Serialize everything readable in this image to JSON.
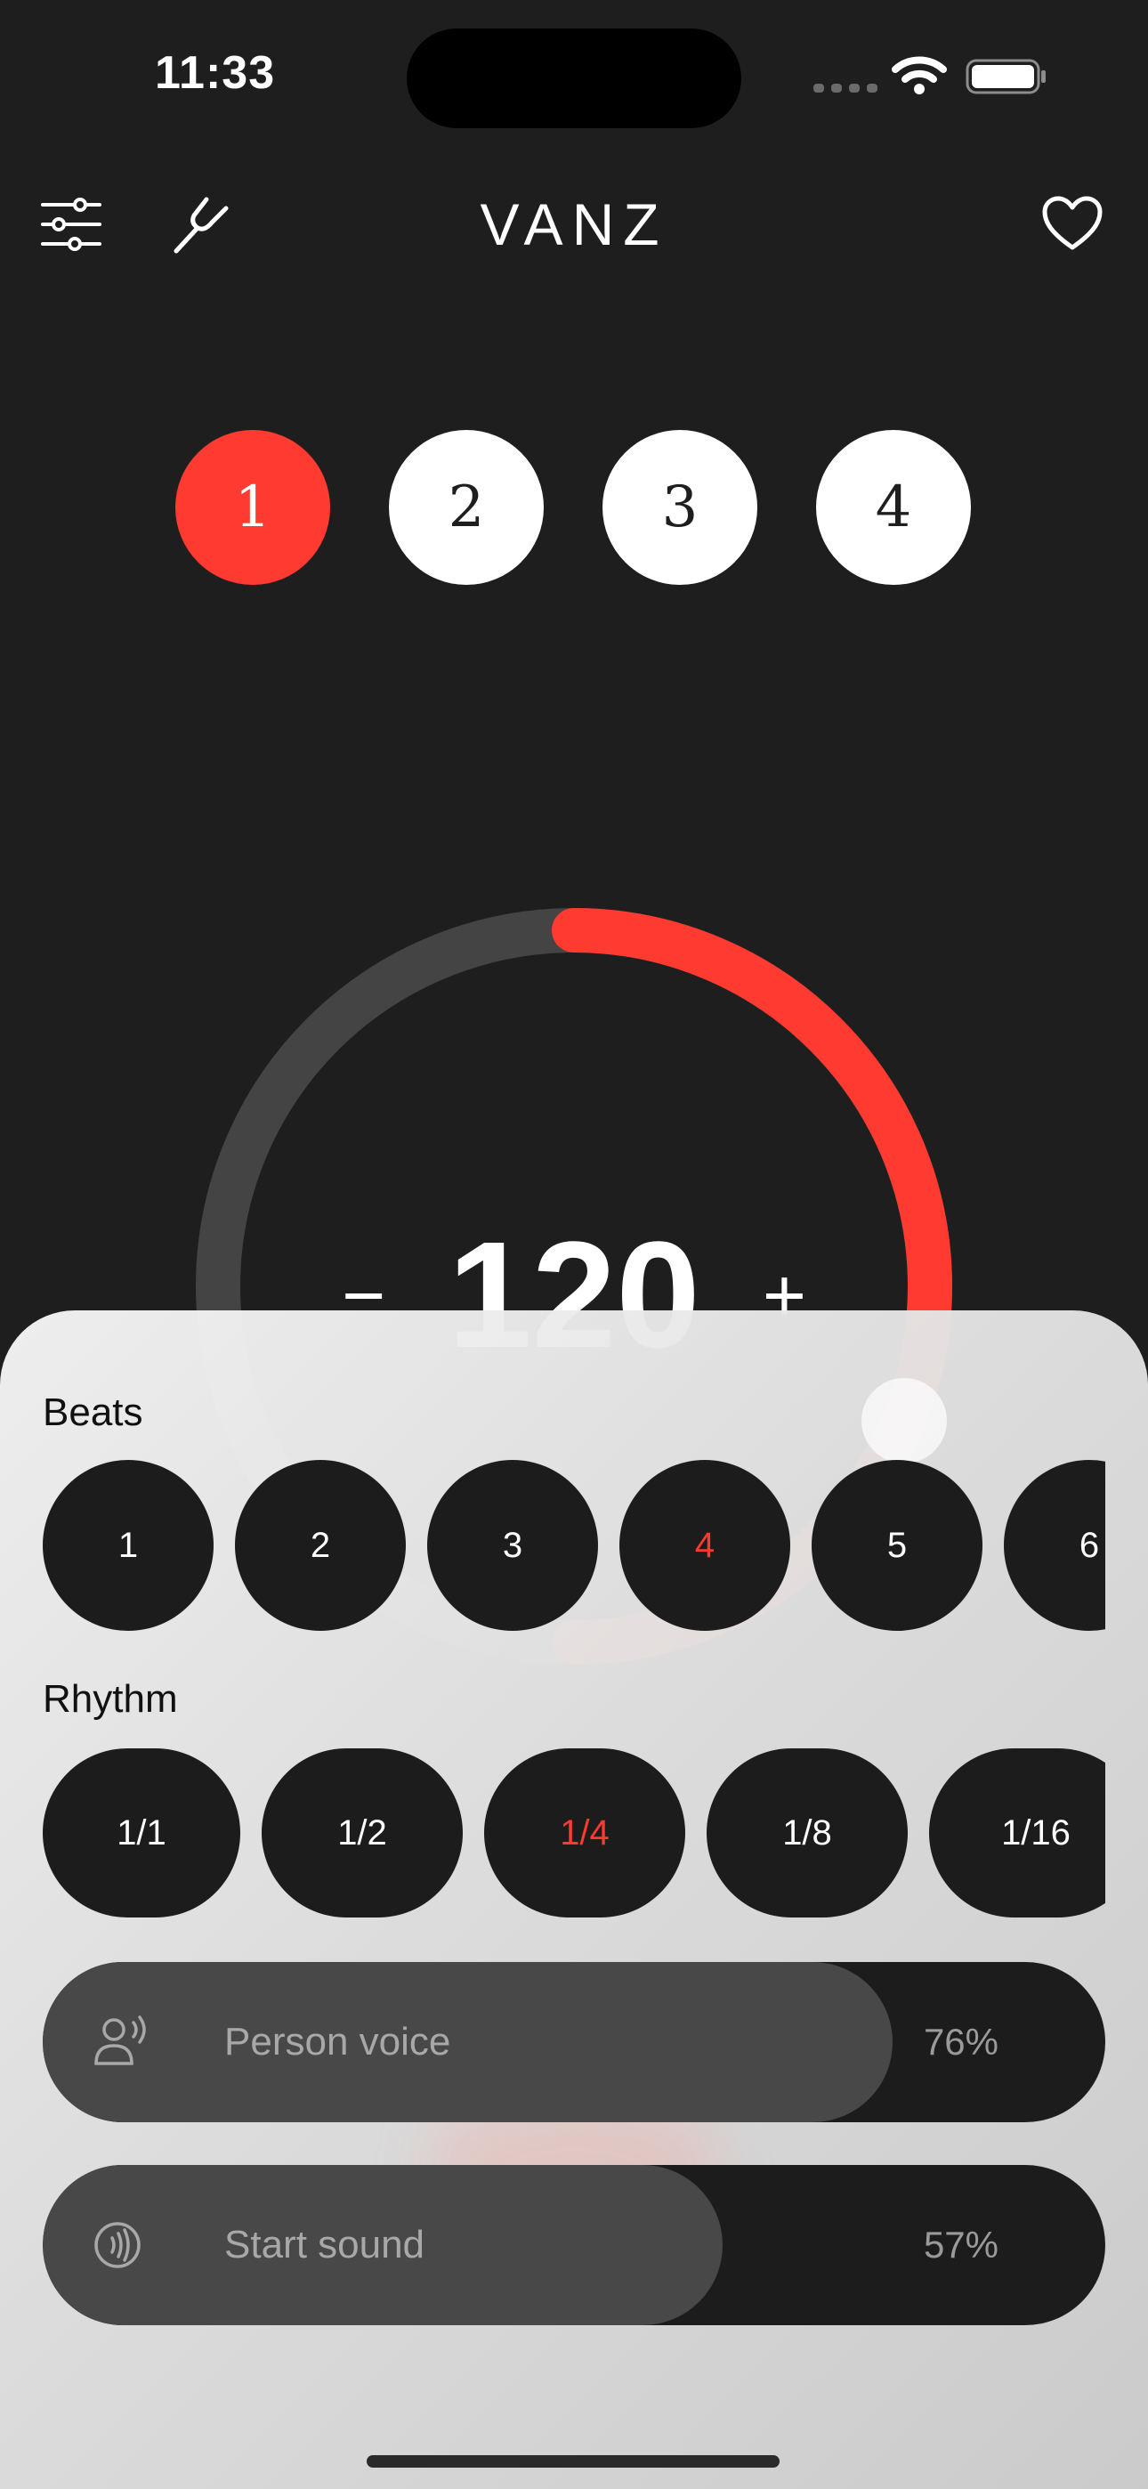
{
  "status_bar": {
    "time": "11:33"
  },
  "header": {
    "brand": "VANZ",
    "left_icons": [
      "sliders-icon",
      "tuning-fork-icon"
    ],
    "right_icon": "heart-icon"
  },
  "beat_indicator": {
    "dots": [
      {
        "label": "1",
        "active": true
      },
      {
        "label": "2",
        "active": false
      },
      {
        "label": "3",
        "active": false
      },
      {
        "label": "4",
        "active": false
      }
    ]
  },
  "tempo": {
    "minus": "−",
    "value": "120",
    "plus": "+",
    "dial_progress": 0.5
  },
  "sheet": {
    "beats_label": "Beats",
    "beats": [
      "1",
      "2",
      "3",
      "4",
      "5",
      "6"
    ],
    "beats_selected": "4",
    "rhythm_label": "Rhythm",
    "rhythms": [
      "1/1",
      "1/2",
      "1/4",
      "1/8",
      "1/16"
    ],
    "rhythm_selected": "1/4",
    "sliders": [
      {
        "label": "Person voice",
        "percent_text": "76%",
        "value": 0.76,
        "icon": "voice-icon"
      },
      {
        "label": "Start sound",
        "percent_text": "57%",
        "value": 0.57,
        "icon": "sound-wave-icon"
      }
    ]
  },
  "colors": {
    "accent": "#ff3a30",
    "background": "#1e1e1e",
    "chip": "#1c1c1c",
    "track": "#444444"
  }
}
